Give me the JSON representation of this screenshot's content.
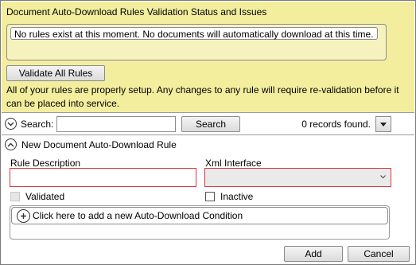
{
  "status": {
    "title": "Document Auto-Download Rules Validation Status and Issues",
    "messages": [
      "No rules exist at this moment.  No documents will automatically download at this time."
    ],
    "validate_button": "Validate All Rules",
    "info": "All of your rules are properly setup.  Any changes to any rule will require re-validation before it can be placed into service."
  },
  "search": {
    "label": "Search:",
    "value": "",
    "button": "Search",
    "records_text": "0 records found."
  },
  "new_rule": {
    "title": "New Document Auto-Download Rule",
    "rule_description_label": "Rule Description",
    "rule_description_value": "",
    "xml_interface_label": "Xml Interface",
    "xml_interface_value": "",
    "validated_label": "Validated",
    "inactive_label": "Inactive",
    "add_condition_text": "Click here to add a new Auto-Download Condition",
    "add_button": "Add",
    "cancel_button": "Cancel"
  },
  "colors": {
    "status_background": "#f3ee9e",
    "error_border": "#d9373f"
  },
  "icons": {
    "search_toggle": "chevron-down-circle-icon",
    "section_toggle": "chevron-up-circle-icon",
    "dropdown": "triangle-down-icon",
    "add_condition": "plus-circle-icon"
  }
}
